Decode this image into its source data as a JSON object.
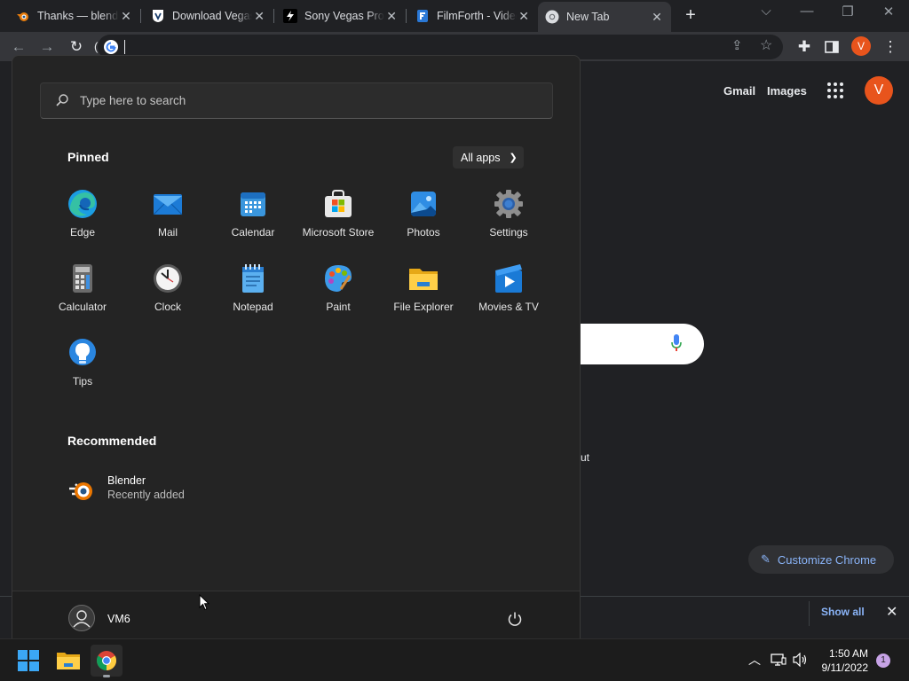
{
  "browser": {
    "tabs": [
      {
        "title": "Thanks — blender.org",
        "favicon": "blender-icon",
        "active": false
      },
      {
        "title": "Download Vegas Pro",
        "favicon": "vegas-icon",
        "active": false
      },
      {
        "title": "Sony Vegas Pro",
        "favicon": "bolt-icon",
        "active": false
      },
      {
        "title": "FilmForth - Video Editor",
        "favicon": "filmforth-icon",
        "active": false
      },
      {
        "title": "New Tab",
        "favicon": "chrome-icon",
        "active": true
      }
    ],
    "new_tab_glyph": "+",
    "omnibox_value": "(",
    "profile_initial": "V"
  },
  "ntp": {
    "gmail": "Gmail",
    "images": "Images",
    "avatar_initial": "V",
    "shortcut_fragment": "ut",
    "customize_label": "Customize Chrome",
    "show_all": "Show all"
  },
  "start_menu": {
    "search_placeholder": "Type here to search",
    "pinned_heading": "Pinned",
    "all_apps_label": "All apps",
    "pinned_apps": [
      {
        "label": "Edge",
        "icon": "edge-icon"
      },
      {
        "label": "Mail",
        "icon": "mail-icon"
      },
      {
        "label": "Calendar",
        "icon": "calendar-icon"
      },
      {
        "label": "Microsoft Store",
        "icon": "store-icon"
      },
      {
        "label": "Photos",
        "icon": "photos-icon"
      },
      {
        "label": "Settings",
        "icon": "settings-icon"
      },
      {
        "label": "Calculator",
        "icon": "calculator-icon"
      },
      {
        "label": "Clock",
        "icon": "clock-icon"
      },
      {
        "label": "Notepad",
        "icon": "notepad-icon"
      },
      {
        "label": "Paint",
        "icon": "paint-icon"
      },
      {
        "label": "File Explorer",
        "icon": "folder-icon"
      },
      {
        "label": "Movies & TV",
        "icon": "movies-icon"
      },
      {
        "label": "Tips",
        "icon": "tips-icon"
      }
    ],
    "recommended_heading": "Recommended",
    "recommended": [
      {
        "name": "Blender",
        "sub": "Recently added",
        "icon": "blender-icon"
      }
    ],
    "user_name": "VM6"
  },
  "taskbar": {
    "time": "1:50 AM",
    "date": "9/11/2022",
    "notification_count": "1"
  },
  "colors": {
    "chrome_dark": "#202124",
    "start_bg": "#242424",
    "accent_blue": "#8ab4f8",
    "profile_orange": "#e8541c"
  }
}
